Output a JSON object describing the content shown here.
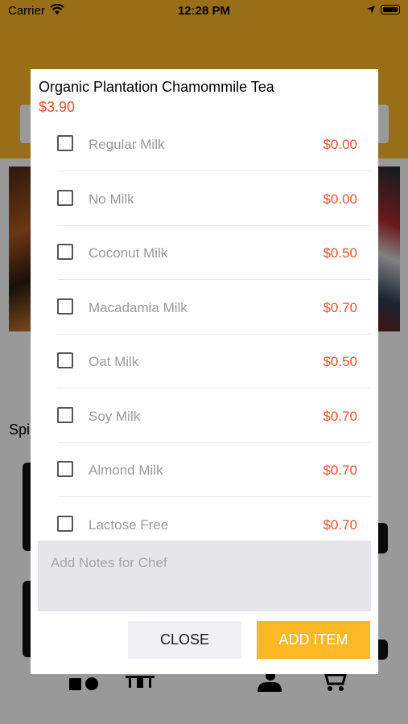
{
  "status_bar": {
    "carrier": "Carrier",
    "time": "12:28 PM"
  },
  "background": {
    "section_title": "Spi"
  },
  "modal": {
    "title": "Organic Plantation Chamommile Tea",
    "price": "$3.90",
    "options": [
      {
        "label": "Regular Milk",
        "price": "$0.00",
        "checked": false
      },
      {
        "label": "No Milk",
        "price": "$0.00",
        "checked": false
      },
      {
        "label": "Coconut Milk",
        "price": "$0.50",
        "checked": false
      },
      {
        "label": "Macadamia Milk",
        "price": "$0.70",
        "checked": false
      },
      {
        "label": "Oat Milk",
        "price": "$0.50",
        "checked": false
      },
      {
        "label": "Soy Milk",
        "price": "$0.70",
        "checked": false
      },
      {
        "label": "Almond Milk",
        "price": "$0.70",
        "checked": false
      },
      {
        "label": "Lactose Free",
        "price": "$0.70",
        "checked": false
      }
    ],
    "notes_placeholder": "Add Notes for Chef",
    "close_label": "CLOSE",
    "add_label": "ADD ITEM"
  },
  "colors": {
    "accent": "#fdb826",
    "price": "#e8522b"
  },
  "icons": [
    "wifi-icon",
    "location-arrow-icon",
    "battery-icon",
    "categories-icon",
    "table-icon",
    "user-icon",
    "cart-icon"
  ]
}
